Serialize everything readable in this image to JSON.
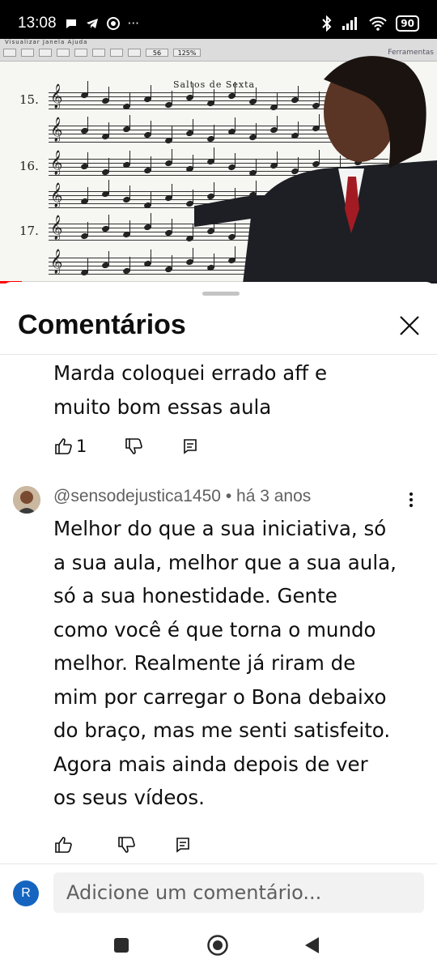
{
  "status_bar": {
    "time": "13:08",
    "battery": "90",
    "more": "···"
  },
  "video": {
    "sheet_title": "Saltos de Sexta",
    "menu_text": "Visualizar  Janela  Ajuda",
    "toolbar_right": "Ferramentas",
    "zoom": "125%",
    "page": "56",
    "staff_numbers": [
      "15.",
      "16.",
      "17."
    ],
    "progress": 0.05,
    "progress_color": "#ff0000"
  },
  "comments_sheet": {
    "title": "Comentários",
    "close_icon": "close-icon"
  },
  "comment1": {
    "text_lines": [
      "Marda coloquei errado aff e",
      "muito bom essas aula"
    ],
    "likes": "1"
  },
  "comment2": {
    "author": "@sensodejustica1450",
    "time": "há 3 anos",
    "separator": "•",
    "text_lines": [
      "Melhor do que a sua iniciativa, só",
      "a sua aula, melhor que a sua aula,",
      "só a sua honestidade. Gente",
      "como você é que torna o mundo",
      "melhor. Realmente já riram de",
      "mim por carregar o Bona debaixo",
      "do braço, mas me senti satisfeito.",
      "Agora mais ainda depois de ver",
      "os seus vídeos."
    ]
  },
  "input": {
    "user_initial": "R",
    "placeholder": "Adicione um comentário..."
  },
  "colors": {
    "accent_red": "#ff0000",
    "user_avatar": "#1565c0",
    "meta_text": "#606060"
  }
}
